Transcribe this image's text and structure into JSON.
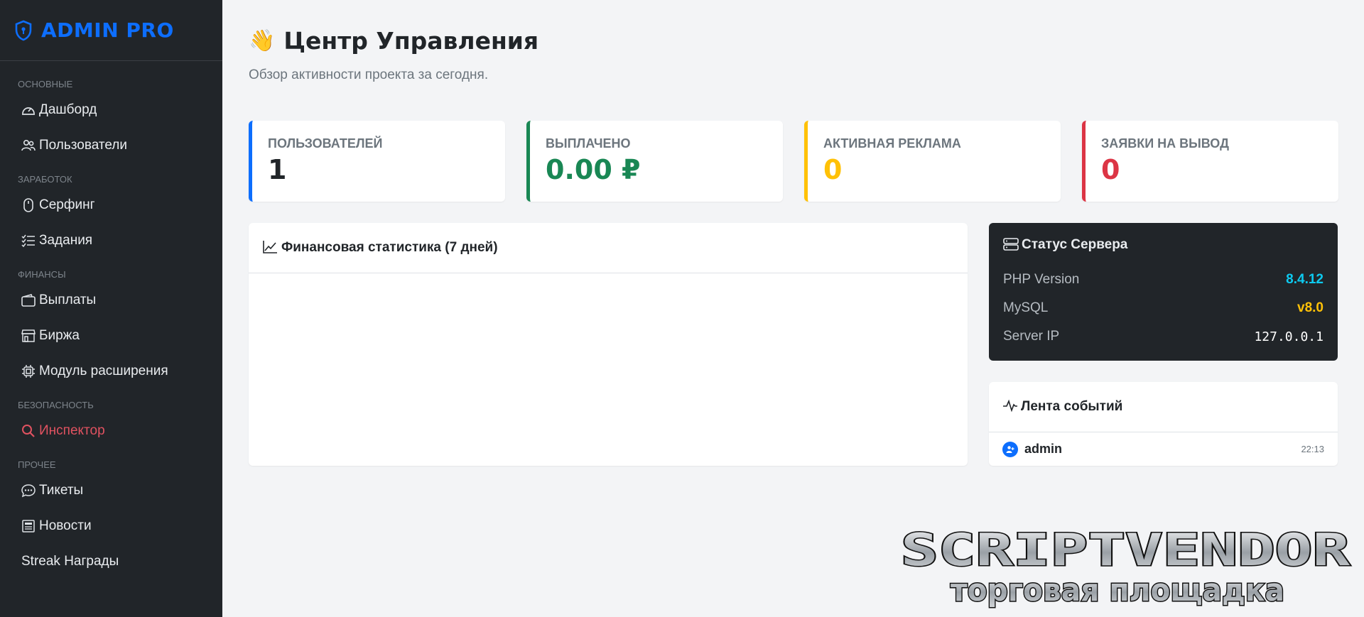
{
  "brand": {
    "name": "ADMIN PRO",
    "color": "#0d6efd"
  },
  "sidebar": {
    "sections": [
      {
        "title": "ОСНОВНЫЕ"
      },
      {
        "title": "ЗАРАБОТОК"
      },
      {
        "title": "ФИНАНСЫ"
      },
      {
        "title": "БЕЗОПАСНОСТЬ"
      },
      {
        "title": "ПРОЧЕЕ"
      }
    ],
    "items": [
      {
        "label": "Дашборд",
        "icon": "speedometer-icon"
      },
      {
        "label": "Пользователи",
        "icon": "people-icon"
      },
      {
        "label": "Серфинг",
        "icon": "mouse-icon"
      },
      {
        "label": "Задания",
        "icon": "list-check-icon"
      },
      {
        "label": "Выплаты",
        "icon": "wallet-icon"
      },
      {
        "label": "Биржа",
        "icon": "shop-icon"
      },
      {
        "label": "Модуль расширения",
        "icon": "cpu-icon"
      },
      {
        "label": "Инспектор",
        "icon": "search-icon",
        "active": true,
        "color": "#e05260"
      },
      {
        "label": "Тикеты",
        "icon": "chat-dots-icon"
      },
      {
        "label": "Новости",
        "icon": "newspaper-icon"
      },
      {
        "label": "Streak Награды"
      }
    ]
  },
  "header": {
    "title": "Центр Управления",
    "subtitle": "Обзор активности проекта за сегодня."
  },
  "stats": [
    {
      "label": "ПОЛЬЗОВАТЕЛЕЙ",
      "value": "1",
      "color": "#0d6efd",
      "value_color": "#212529"
    },
    {
      "label": "ВЫПЛАЧЕНО",
      "value": "0.00 ₽",
      "color": "#198754",
      "value_color": "#198754"
    },
    {
      "label": "АКТИВНАЯ РЕКЛАМА",
      "value": "0",
      "color": "#ffc107",
      "value_color": "#ffc107"
    },
    {
      "label": "ЗАЯВКИ НА ВЫВОД",
      "value": "0",
      "color": "#dc3545",
      "value_color": "#dc3545"
    }
  ],
  "finance": {
    "title": "Финансовая статистика (7 дней)"
  },
  "server": {
    "title": "Статус Сервера",
    "rows": [
      {
        "label": "PHP Version",
        "value": "8.4.12",
        "color": "#0dcaf0"
      },
      {
        "label": "MySQL",
        "value": "v8.0",
        "color": "#ffc107"
      },
      {
        "label": "Server IP",
        "value": "127.0.0.1",
        "color": "#ffffff"
      }
    ]
  },
  "events": {
    "title": "Лента событий",
    "items": [
      {
        "user": "admin",
        "time": "22:13"
      }
    ]
  },
  "watermark": {
    "line1": "SCRIPTVENDOR",
    "line2": "торговая площадка"
  }
}
